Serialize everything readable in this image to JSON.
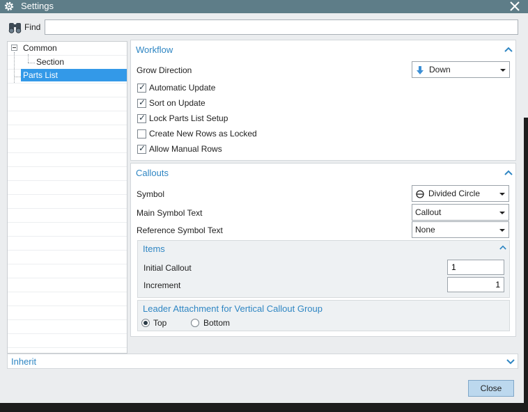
{
  "window": {
    "title": "Settings",
    "close_icon": "close-icon",
    "app_icon": "gear-icon"
  },
  "find": {
    "label": "Find",
    "value": "",
    "icon": "binoculars-icon"
  },
  "tree": {
    "items": [
      {
        "label": "Common",
        "expanded": true
      },
      {
        "label": "Section"
      },
      {
        "label": "Parts List",
        "selected": true
      }
    ]
  },
  "workflow": {
    "header": "Workflow",
    "grow_direction_label": "Grow Direction",
    "grow_direction_value": "Down",
    "checks": [
      {
        "label": "Automatic Update",
        "checked": true
      },
      {
        "label": "Sort on Update",
        "checked": true
      },
      {
        "label": "Lock Parts List Setup",
        "checked": true
      },
      {
        "label": "Create New Rows as Locked",
        "checked": false
      },
      {
        "label": "Allow Manual Rows",
        "checked": true
      }
    ]
  },
  "callouts": {
    "header": "Callouts",
    "symbol_label": "Symbol",
    "symbol_value": "Divided Circle",
    "main_text_label": "Main Symbol Text",
    "main_text_value": "Callout",
    "ref_text_label": "Reference Symbol Text",
    "ref_text_value": "None",
    "items": {
      "header": "Items",
      "initial_label": "Initial Callout",
      "initial_value": "1",
      "increment_label": "Increment",
      "increment_value": "1"
    },
    "leader": {
      "header": "Leader Attachment for Vertical Callout Group",
      "options": [
        {
          "label": "Top",
          "selected": true
        },
        {
          "label": "Bottom",
          "selected": false
        }
      ]
    }
  },
  "inherit": {
    "label": "Inherit"
  },
  "buttons": {
    "close": "Close"
  },
  "colors": {
    "titlebar": "#5e7d88",
    "accent": "#2f86c3",
    "selection": "#3399e8",
    "button": "#bcd8ee"
  }
}
